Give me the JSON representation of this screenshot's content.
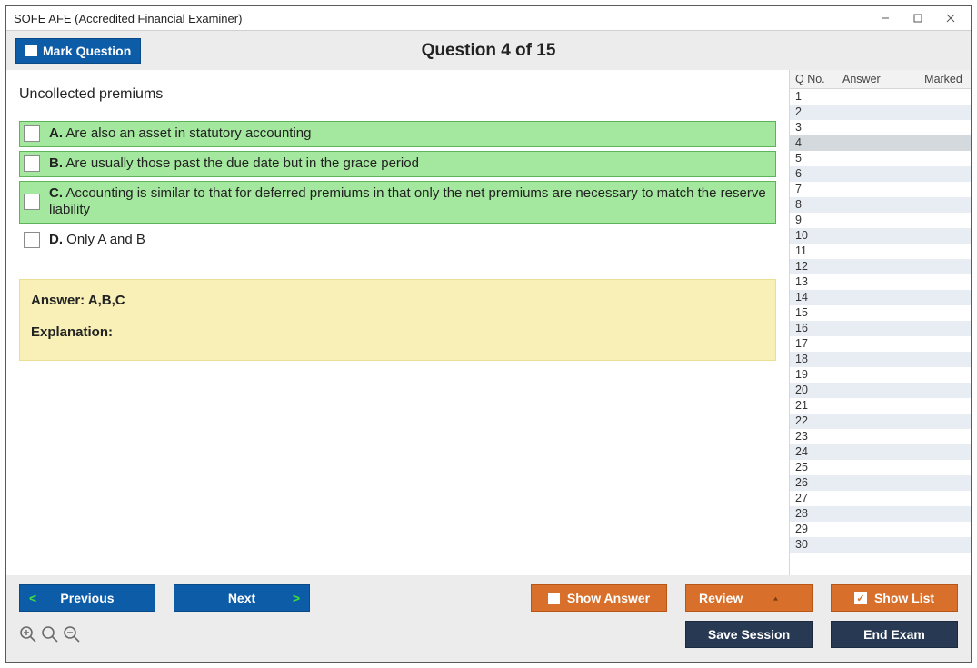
{
  "window": {
    "title": "SOFE AFE (Accredited Financial Examiner)"
  },
  "topbar": {
    "mark_label": "Mark Question",
    "question_title": "Question 4 of 15"
  },
  "question": {
    "stem": "Uncollected premiums",
    "options": [
      {
        "letter": "A.",
        "text": "Are also an asset in statutory accounting",
        "highlight": true
      },
      {
        "letter": "B.",
        "text": "Are usually those past the due date but in the grace period",
        "highlight": true
      },
      {
        "letter": "C.",
        "text": "Accounting is similar to that for deferred premiums in that only the net premiums are necessary to match the reserve liability",
        "highlight": true
      },
      {
        "letter": "D.",
        "text": "Only A and B",
        "highlight": false
      }
    ],
    "answer_line": "Answer: A,B,C",
    "explanation_label": "Explanation:"
  },
  "sidebar": {
    "headers": {
      "qno": "Q No.",
      "answer": "Answer",
      "marked": "Marked"
    },
    "rows": [
      1,
      2,
      3,
      4,
      5,
      6,
      7,
      8,
      9,
      10,
      11,
      12,
      13,
      14,
      15,
      16,
      17,
      18,
      19,
      20,
      21,
      22,
      23,
      24,
      25,
      26,
      27,
      28,
      29,
      30
    ],
    "selected": 4
  },
  "footer": {
    "prev": "Previous",
    "next": "Next",
    "show_answer": "Show Answer",
    "review": "Review",
    "show_list": "Show List",
    "save_session": "Save Session",
    "end_exam": "End Exam"
  }
}
